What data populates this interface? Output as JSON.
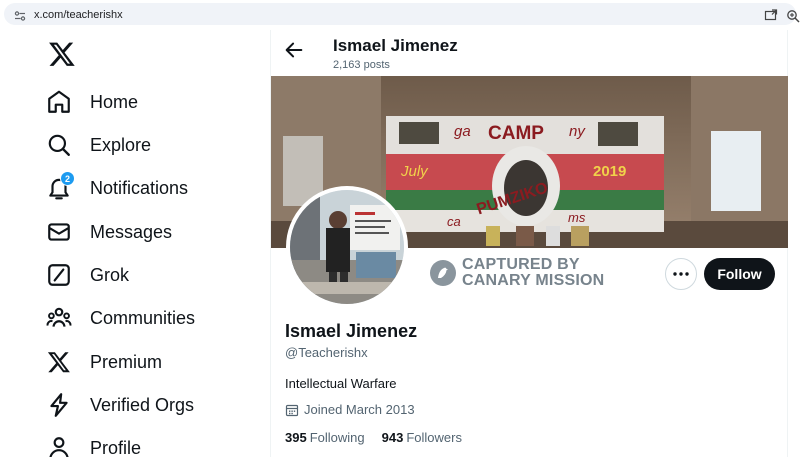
{
  "browser": {
    "url": "x.com/teacherishx"
  },
  "sidebar": {
    "items": [
      {
        "label": "Home",
        "icon": "home-icon"
      },
      {
        "label": "Explore",
        "icon": "search-icon"
      },
      {
        "label": "Notifications",
        "icon": "bell-icon",
        "badge": "2"
      },
      {
        "label": "Messages",
        "icon": "envelope-icon"
      },
      {
        "label": "Grok",
        "icon": "grok-icon"
      },
      {
        "label": "Communities",
        "icon": "people-icon"
      },
      {
        "label": "Premium",
        "icon": "x-logo-icon"
      },
      {
        "label": "Verified Orgs",
        "icon": "lightning-icon"
      },
      {
        "label": "Profile",
        "icon": "person-icon"
      }
    ]
  },
  "header": {
    "name": "Ismael Jimenez",
    "posts": "2,163 posts"
  },
  "watermark": {
    "line1": "CAPTURED BY",
    "line2": "CANARY MISSION"
  },
  "profile": {
    "name": "Ismael Jimenez",
    "handle": "@Teacherishx",
    "bio": "Intellectual Warfare",
    "joined": "Joined March 2013",
    "following_count": "395",
    "following_label": "Following",
    "followers_count": "943",
    "followers_label": "Followers",
    "follow_label": "Follow"
  },
  "banner": {
    "texts": [
      "ga",
      "CAMP",
      "ny",
      "July",
      "2019",
      "PUMZIKO",
      "ca",
      "ms"
    ]
  },
  "colors": {
    "accent": "#1d9bf0",
    "text": "#0f1419",
    "muted": "#536471",
    "button": "#0f1419"
  }
}
